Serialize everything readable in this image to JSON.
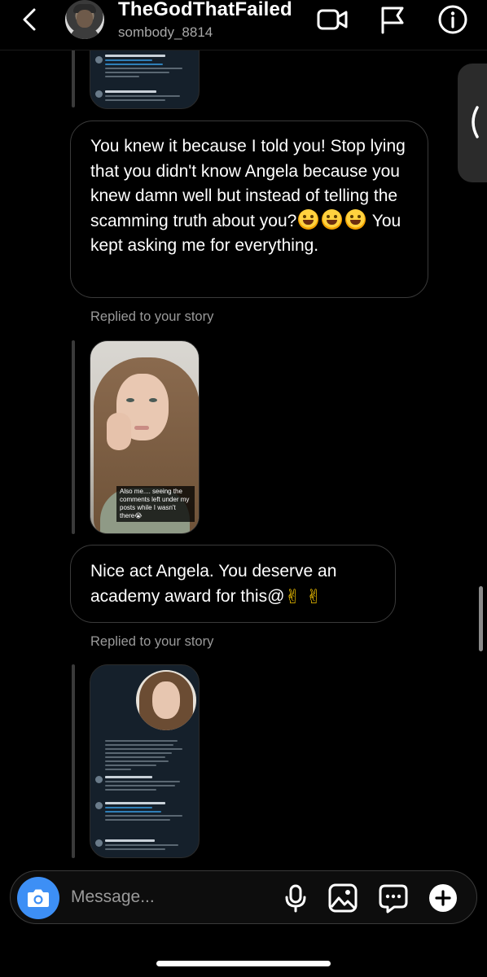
{
  "header": {
    "title": "TheGodThatFailed",
    "username": "sombody_8814"
  },
  "messages": {
    "bubble1_text": "You knew it because I told you! Stop lying that you didn't know Angela because you knew damn well but instead of telling the scamming truth about you?",
    "bubble1_tail": "You kept asking me for everything.",
    "replied_label_1": "Replied to your story",
    "story_caption": "Also me.... seeing the comments left under my posts while I wasn't there😭",
    "bubble2_text": "Nice act Angela.  You deserve an academy award for this@",
    "replied_label_2": "Replied to your story"
  },
  "composer": {
    "placeholder": "Message..."
  },
  "icons": {
    "back": "chevron-left-icon",
    "video": "video-camera-icon",
    "flag": "flag-icon",
    "info": "info-icon",
    "camera": "camera-icon",
    "mic": "microphone-icon",
    "gallery": "image-icon",
    "sticker": "chat-bubble-dots-icon",
    "plus": "plus-circle-icon"
  },
  "colors": {
    "background": "#000000",
    "accent_blue": "#3d8ff5",
    "muted_text": "#9a9a9a"
  }
}
